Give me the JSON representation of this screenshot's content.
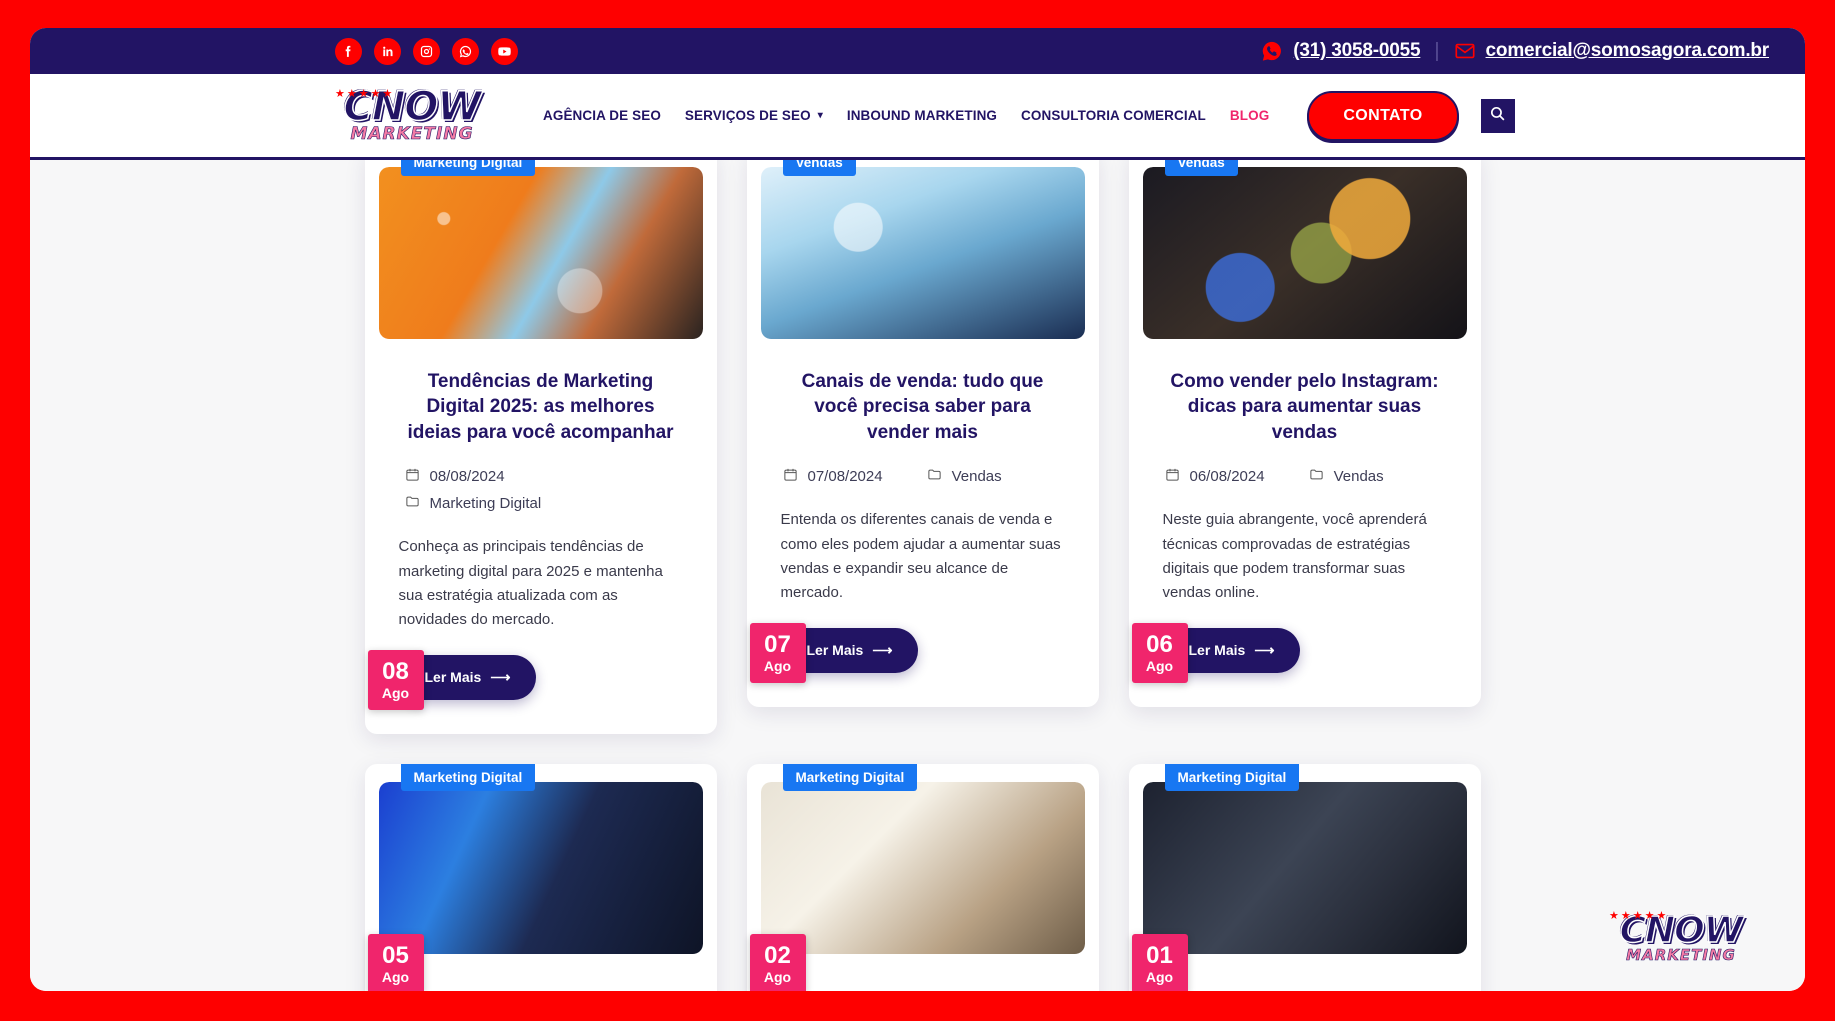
{
  "topbar": {
    "social": [
      {
        "name": "facebook-icon",
        "label": "Facebook"
      },
      {
        "name": "linkedin-icon",
        "label": "LinkedIn"
      },
      {
        "name": "instagram-icon",
        "label": "Instagram"
      },
      {
        "name": "whatsapp-icon",
        "label": "WhatsApp"
      },
      {
        "name": "youtube-icon",
        "label": "YouTube"
      }
    ],
    "phone": "(31) 3058-0055",
    "email": "comercial@somosagora.com.br"
  },
  "logo": {
    "main": "CNOW",
    "sub": "MARKETING",
    "stars": "★★★★★"
  },
  "nav": {
    "items": [
      {
        "label": "AGÊNCIA DE SEO",
        "has_caret": false,
        "active": false
      },
      {
        "label": "SERVIÇOS DE SEO",
        "has_caret": true,
        "active": false
      },
      {
        "label": "INBOUND MARKETING",
        "has_caret": false,
        "active": false
      },
      {
        "label": "CONSULTORIA COMERCIAL",
        "has_caret": false,
        "active": false
      },
      {
        "label": "BLOG",
        "has_caret": false,
        "active": true
      }
    ],
    "contact_button": "CONTATO",
    "search_icon": "search-icon"
  },
  "colors": {
    "navy": "#221464",
    "red": "#fe0000",
    "pink": "#f0256c",
    "blue_badge": "#1877f2",
    "blog_link": "#f0256c"
  },
  "blog": {
    "read_more_label": "Ler Mais",
    "read_more_arrow": "⟶",
    "posts": [
      {
        "category": "Marketing Digital",
        "day": "08",
        "month": "Ago",
        "title": "Tendências de Marketing Digital 2025: as melhores ideias para você acompanhar",
        "date": "08/08/2024",
        "tag": "Marketing Digital",
        "excerpt": "Conheça as principais tendências de marketing digital para 2025 e mantenha sua estratégia atualizada com as novidades do mercado.",
        "meta_stacked": true,
        "thumb_class": "t1"
      },
      {
        "category": "Vendas",
        "day": "07",
        "month": "Ago",
        "title": "Canais de venda: tudo que você precisa saber para vender mais",
        "date": "07/08/2024",
        "tag": "Vendas",
        "excerpt": "Entenda os diferentes canais de venda e como eles podem ajudar a aumentar suas vendas e expandir seu alcance de mercado.",
        "meta_stacked": false,
        "thumb_class": "t2"
      },
      {
        "category": "Vendas",
        "day": "06",
        "month": "Ago",
        "title": "Como vender pelo Instagram: dicas para aumentar suas vendas",
        "date": "06/08/2024",
        "tag": "Vendas",
        "excerpt": "Neste guia abrangente, você aprenderá técnicas comprovadas de estratégias digitais que podem transformar suas vendas online.",
        "meta_stacked": false,
        "thumb_class": "t3"
      },
      {
        "category": "Marketing Digital",
        "day": "05",
        "month": "Ago",
        "title": "",
        "date": "",
        "tag": "",
        "excerpt": "",
        "meta_stacked": false,
        "thumb_class": "t4"
      },
      {
        "category": "Marketing Digital",
        "day": "02",
        "month": "Ago",
        "title": "",
        "date": "",
        "tag": "",
        "excerpt": "",
        "meta_stacked": false,
        "thumb_class": "t5"
      },
      {
        "category": "Marketing Digital",
        "day": "01",
        "month": "Ago",
        "title": "",
        "date": "",
        "tag": "",
        "excerpt": "",
        "meta_stacked": false,
        "thumb_class": "t6"
      }
    ]
  }
}
